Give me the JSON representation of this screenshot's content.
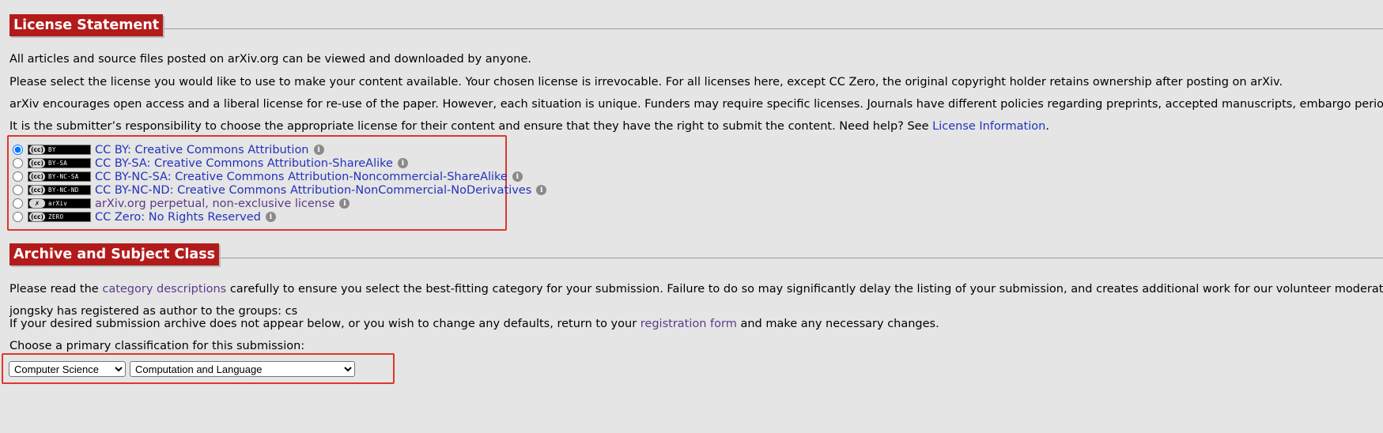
{
  "license": {
    "header": "License Statement",
    "p1": "All articles and source files posted on arXiv.org can be viewed and downloaded by anyone.",
    "p2": "Please select the license you would like to use to make your content available. Your chosen license is irrevocable. For all licenses here, except CC Zero, the original copyright holder retains ownership after posting on arXiv.",
    "p3": "arXiv encourages open access and a liberal license for re-use of the paper. However, each situation is unique. Funders may require specific licenses. Journals have different policies regarding preprints, accepted manuscripts, embargo periods, and p",
    "p4_prefix": "It is the submitter’s responsibility to choose the appropriate license for their content and ensure that they have the right to submit the content. Need help? See ",
    "p4_link": "License Information",
    "p4_suffix": ".",
    "options": [
      {
        "badge": "BY",
        "label": "CC BY: Creative Commons Attribution",
        "selected": true
      },
      {
        "badge": "BY-SA",
        "label": "CC BY-SA: Creative Commons Attribution-ShareAlike",
        "selected": false
      },
      {
        "badge": "BY-NC-SA",
        "label": "CC BY-NC-SA: Creative Commons Attribution-Noncommercial-ShareAlike",
        "selected": false
      },
      {
        "badge": "BY-NC-ND",
        "label": "CC BY-NC-ND: Creative Commons Attribution-NonCommercial-NoDerivatives",
        "selected": false
      },
      {
        "badge": "arXiv",
        "label": "arXiv.org perpetual, non-exclusive license",
        "selected": false
      },
      {
        "badge": "ZERO",
        "label": "CC Zero: No Rights Reserved",
        "selected": false
      }
    ]
  },
  "archive": {
    "header": "Archive and Subject Class",
    "p1_prefix": "Please read the ",
    "p1_link": "category descriptions",
    "p1_suffix": " carefully to ensure you select the best-fitting category for your submission. Failure to do so may significantly delay the listing of your submission, and creates additional work for our volunteer moderators.",
    "registered": "jongsky has registered as author to the groups: cs",
    "p2_prefix": "If your desired submission archive does not appear below, or you wish to change any defaults, return to your ",
    "p2_link": "registration form",
    "p2_suffix": " and make any necessary changes.",
    "choose": "Choose a primary classification for this submission:",
    "archive_select": "Computer Science",
    "subject_select": "Computation and Language"
  },
  "colors": {
    "header_bg": "#b31b1b",
    "highlight_box": "#e0362b",
    "link": "#2233bb"
  }
}
